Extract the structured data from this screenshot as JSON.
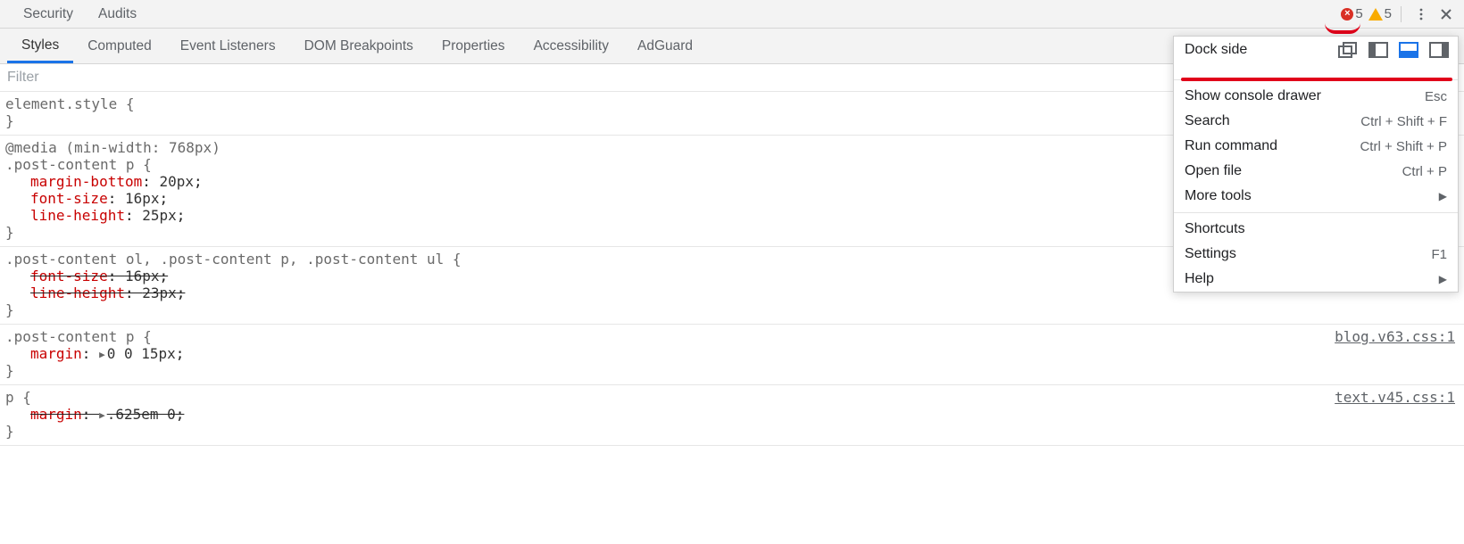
{
  "topbar": {
    "tabs": [
      "Security",
      "Audits"
    ],
    "errors_count": "5",
    "warnings_count": "5"
  },
  "subtabs": {
    "items": [
      "Styles",
      "Computed",
      "Event Listeners",
      "DOM Breakpoints",
      "Properties",
      "Accessibility",
      "AdGuard"
    ],
    "active": "Styles"
  },
  "filter_placeholder": "Filter",
  "styles": {
    "rules": [
      {
        "selector": "element.style {",
        "declarations": [],
        "close": "}"
      },
      {
        "media": "@media (min-width: 768px)",
        "selector": ".post-content p {",
        "declarations": [
          {
            "prop": "margin-bottom",
            "val": "20px",
            "strike": false
          },
          {
            "prop": "font-size",
            "val": "16px",
            "strike": false
          },
          {
            "prop": "line-height",
            "val": "25px",
            "strike": false
          }
        ],
        "close": "}"
      },
      {
        "selector": ".post-content ol, .post-content p, .post-content ul {",
        "declarations": [
          {
            "prop": "font-size",
            "val": "16px",
            "strike": true
          },
          {
            "prop": "line-height",
            "val": "23px",
            "strike": true
          }
        ],
        "close": "}"
      },
      {
        "selector": ".post-content p {",
        "source": "blog.v63.css:1",
        "declarations": [
          {
            "prop": "margin",
            "val": "0 0 15px",
            "expand": true,
            "strike": false
          }
        ],
        "close": "}"
      },
      {
        "selector": "p {",
        "source": "text.v45.css:1",
        "declarations": [
          {
            "prop": "margin",
            "val": ".625em 0",
            "expand": true,
            "strike": true
          }
        ],
        "close": "}"
      }
    ]
  },
  "dropdown": {
    "dock_label": "Dock side",
    "rows": [
      {
        "label": "Show console drawer",
        "shortcut": "Esc"
      },
      {
        "label": "Search",
        "shortcut": "Ctrl + Shift + F"
      },
      {
        "label": "Run command",
        "shortcut": "Ctrl + Shift + P"
      },
      {
        "label": "Open file",
        "shortcut": "Ctrl + P"
      },
      {
        "label": "More tools",
        "submenu": true
      }
    ],
    "rows2": [
      {
        "label": "Shortcuts"
      },
      {
        "label": "Settings",
        "shortcut": "F1"
      },
      {
        "label": "Help",
        "submenu": true
      }
    ]
  }
}
